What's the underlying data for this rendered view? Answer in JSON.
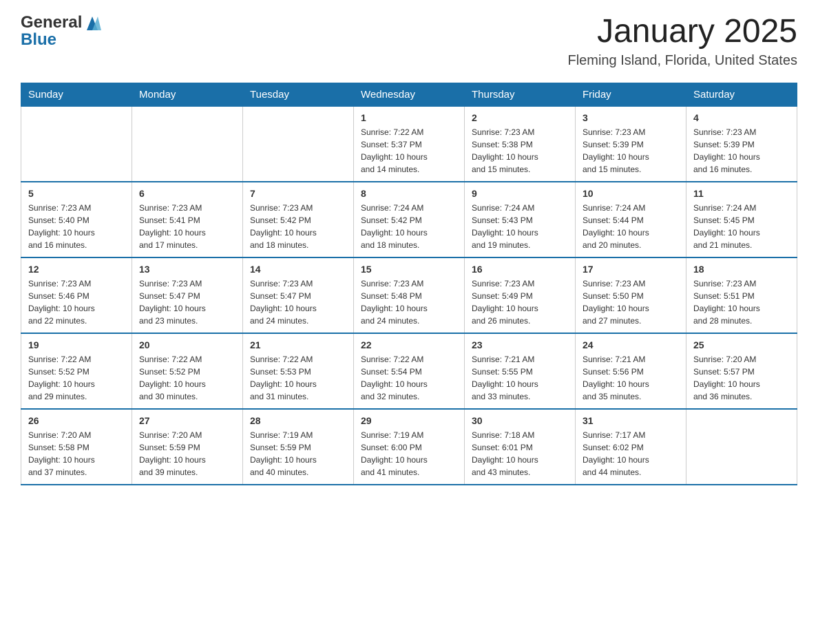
{
  "header": {
    "logo_general": "General",
    "logo_blue": "Blue",
    "month_title": "January 2025",
    "location": "Fleming Island, Florida, United States"
  },
  "days_of_week": [
    "Sunday",
    "Monday",
    "Tuesday",
    "Wednesday",
    "Thursday",
    "Friday",
    "Saturday"
  ],
  "weeks": [
    [
      {
        "day": "",
        "info": ""
      },
      {
        "day": "",
        "info": ""
      },
      {
        "day": "",
        "info": ""
      },
      {
        "day": "1",
        "info": "Sunrise: 7:22 AM\nSunset: 5:37 PM\nDaylight: 10 hours\nand 14 minutes."
      },
      {
        "day": "2",
        "info": "Sunrise: 7:23 AM\nSunset: 5:38 PM\nDaylight: 10 hours\nand 15 minutes."
      },
      {
        "day": "3",
        "info": "Sunrise: 7:23 AM\nSunset: 5:39 PM\nDaylight: 10 hours\nand 15 minutes."
      },
      {
        "day": "4",
        "info": "Sunrise: 7:23 AM\nSunset: 5:39 PM\nDaylight: 10 hours\nand 16 minutes."
      }
    ],
    [
      {
        "day": "5",
        "info": "Sunrise: 7:23 AM\nSunset: 5:40 PM\nDaylight: 10 hours\nand 16 minutes."
      },
      {
        "day": "6",
        "info": "Sunrise: 7:23 AM\nSunset: 5:41 PM\nDaylight: 10 hours\nand 17 minutes."
      },
      {
        "day": "7",
        "info": "Sunrise: 7:23 AM\nSunset: 5:42 PM\nDaylight: 10 hours\nand 18 minutes."
      },
      {
        "day": "8",
        "info": "Sunrise: 7:24 AM\nSunset: 5:42 PM\nDaylight: 10 hours\nand 18 minutes."
      },
      {
        "day": "9",
        "info": "Sunrise: 7:24 AM\nSunset: 5:43 PM\nDaylight: 10 hours\nand 19 minutes."
      },
      {
        "day": "10",
        "info": "Sunrise: 7:24 AM\nSunset: 5:44 PM\nDaylight: 10 hours\nand 20 minutes."
      },
      {
        "day": "11",
        "info": "Sunrise: 7:24 AM\nSunset: 5:45 PM\nDaylight: 10 hours\nand 21 minutes."
      }
    ],
    [
      {
        "day": "12",
        "info": "Sunrise: 7:23 AM\nSunset: 5:46 PM\nDaylight: 10 hours\nand 22 minutes."
      },
      {
        "day": "13",
        "info": "Sunrise: 7:23 AM\nSunset: 5:47 PM\nDaylight: 10 hours\nand 23 minutes."
      },
      {
        "day": "14",
        "info": "Sunrise: 7:23 AM\nSunset: 5:47 PM\nDaylight: 10 hours\nand 24 minutes."
      },
      {
        "day": "15",
        "info": "Sunrise: 7:23 AM\nSunset: 5:48 PM\nDaylight: 10 hours\nand 24 minutes."
      },
      {
        "day": "16",
        "info": "Sunrise: 7:23 AM\nSunset: 5:49 PM\nDaylight: 10 hours\nand 26 minutes."
      },
      {
        "day": "17",
        "info": "Sunrise: 7:23 AM\nSunset: 5:50 PM\nDaylight: 10 hours\nand 27 minutes."
      },
      {
        "day": "18",
        "info": "Sunrise: 7:23 AM\nSunset: 5:51 PM\nDaylight: 10 hours\nand 28 minutes."
      }
    ],
    [
      {
        "day": "19",
        "info": "Sunrise: 7:22 AM\nSunset: 5:52 PM\nDaylight: 10 hours\nand 29 minutes."
      },
      {
        "day": "20",
        "info": "Sunrise: 7:22 AM\nSunset: 5:52 PM\nDaylight: 10 hours\nand 30 minutes."
      },
      {
        "day": "21",
        "info": "Sunrise: 7:22 AM\nSunset: 5:53 PM\nDaylight: 10 hours\nand 31 minutes."
      },
      {
        "day": "22",
        "info": "Sunrise: 7:22 AM\nSunset: 5:54 PM\nDaylight: 10 hours\nand 32 minutes."
      },
      {
        "day": "23",
        "info": "Sunrise: 7:21 AM\nSunset: 5:55 PM\nDaylight: 10 hours\nand 33 minutes."
      },
      {
        "day": "24",
        "info": "Sunrise: 7:21 AM\nSunset: 5:56 PM\nDaylight: 10 hours\nand 35 minutes."
      },
      {
        "day": "25",
        "info": "Sunrise: 7:20 AM\nSunset: 5:57 PM\nDaylight: 10 hours\nand 36 minutes."
      }
    ],
    [
      {
        "day": "26",
        "info": "Sunrise: 7:20 AM\nSunset: 5:58 PM\nDaylight: 10 hours\nand 37 minutes."
      },
      {
        "day": "27",
        "info": "Sunrise: 7:20 AM\nSunset: 5:59 PM\nDaylight: 10 hours\nand 39 minutes."
      },
      {
        "day": "28",
        "info": "Sunrise: 7:19 AM\nSunset: 5:59 PM\nDaylight: 10 hours\nand 40 minutes."
      },
      {
        "day": "29",
        "info": "Sunrise: 7:19 AM\nSunset: 6:00 PM\nDaylight: 10 hours\nand 41 minutes."
      },
      {
        "day": "30",
        "info": "Sunrise: 7:18 AM\nSunset: 6:01 PM\nDaylight: 10 hours\nand 43 minutes."
      },
      {
        "day": "31",
        "info": "Sunrise: 7:17 AM\nSunset: 6:02 PM\nDaylight: 10 hours\nand 44 minutes."
      },
      {
        "day": "",
        "info": ""
      }
    ]
  ]
}
